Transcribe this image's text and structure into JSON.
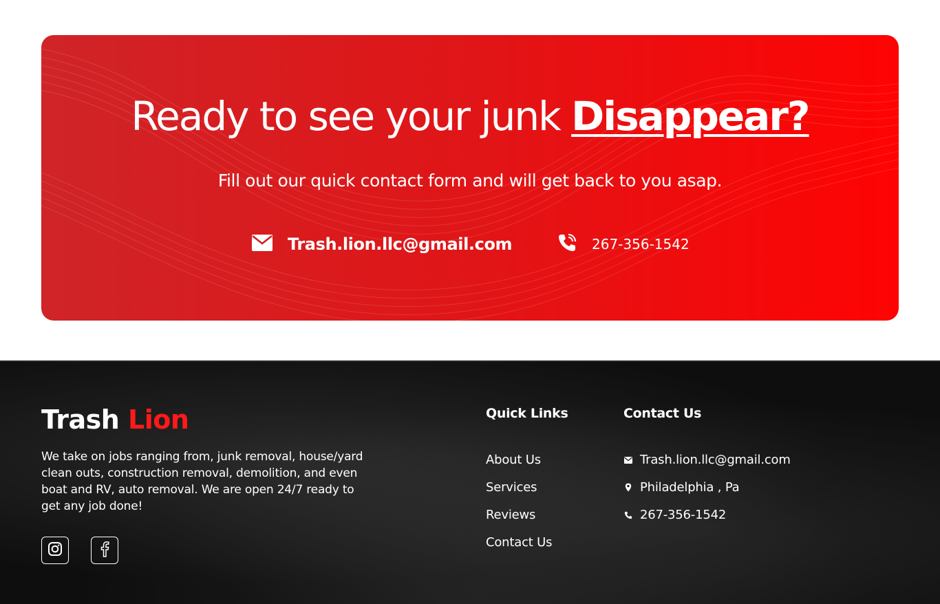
{
  "cta": {
    "title_main": "Ready to see your junk ",
    "title_accent": "Disappear?",
    "subtitle": "Fill out our quick contact form and will get back to you asap.",
    "email": "Trash.lion.llc@gmail.com",
    "phone": "267-356-1542",
    "email_icon": "mail-icon",
    "phone_icon": "phone-icon"
  },
  "footer": {
    "brand_part1": "Trash ",
    "brand_part2": "Lion",
    "description": "We take on jobs ranging from, junk removal, house/yard clean outs, construction removal, demolition, and even boat and RV, auto removal. We are open 24/7 ready to get any job done!",
    "social": [
      {
        "icon": "instagram-icon"
      },
      {
        "icon": "facebook-icon"
      }
    ],
    "quick_links": {
      "title": "Quick Links",
      "items": [
        "About Us",
        "Services",
        "Reviews",
        "Contact Us"
      ]
    },
    "contact": {
      "title": "Contact Us",
      "email": "Trash.lion.llc@gmail.com",
      "location": "Philadelphia , Pa",
      "phone": "267-356-1542"
    }
  },
  "colors": {
    "banner_left": "#cf2428",
    "banner_right": "#ff0303",
    "brand_accent": "#ff1a1a",
    "footer_bg": "#0e0e0e"
  }
}
